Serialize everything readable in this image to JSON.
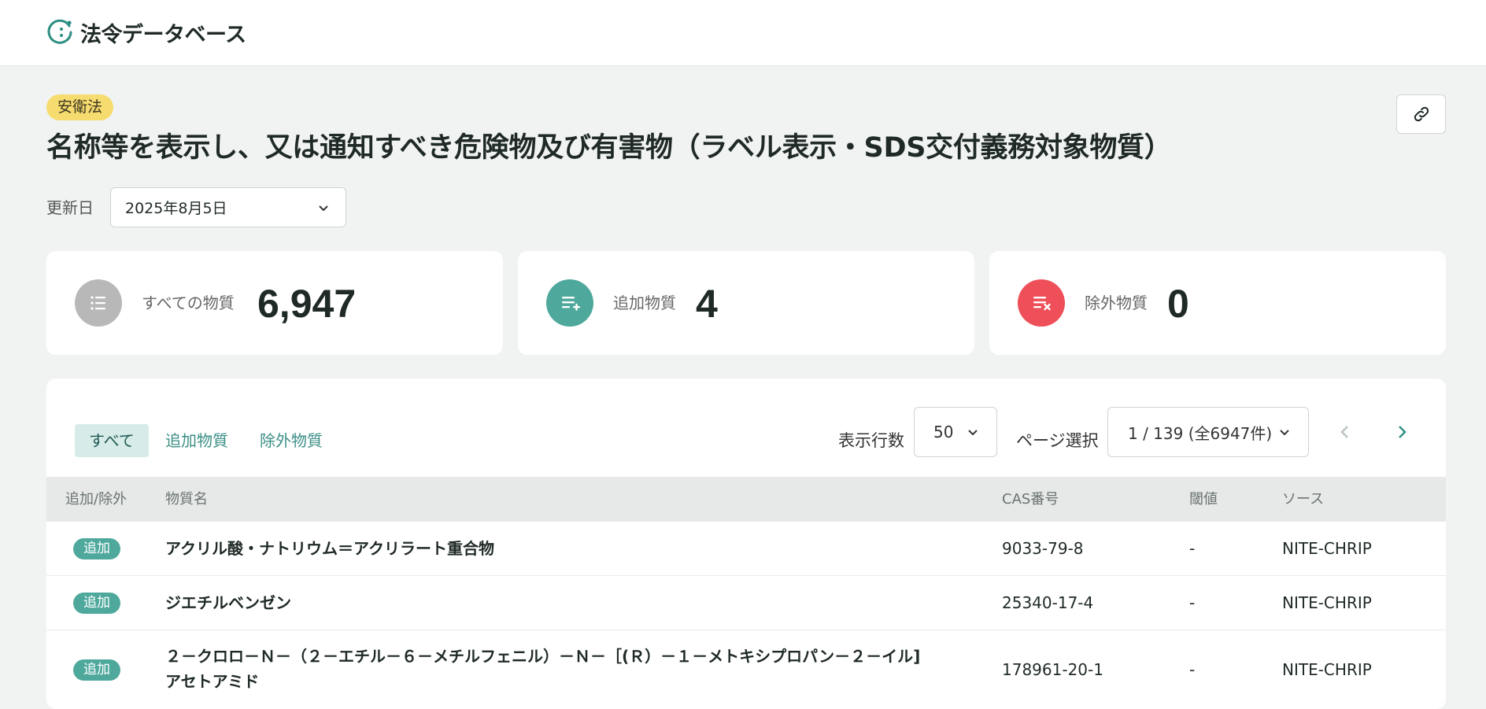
{
  "header": {
    "app_name": "法令データベース"
  },
  "law": {
    "tag": "安衛法",
    "title": "名称等を表示し、又は通知すべき危険物及び有害物（ラベル表示・SDS交付義務対象物質）",
    "date_label": "更新日",
    "date_value": "2025年8月5日"
  },
  "stats": [
    {
      "label": "すべての物質",
      "value": "6,947",
      "icon": "list-icon",
      "color": "#b8b8b8"
    },
    {
      "label": "追加物質",
      "value": "4",
      "icon": "list-add-icon",
      "color": "#4fa89c"
    },
    {
      "label": "除外物質",
      "value": "0",
      "icon": "list-remove-icon",
      "color": "#ee4f58"
    }
  ],
  "filters": {
    "all": "すべて",
    "added": "追加物質",
    "removed": "除外物質"
  },
  "pagination": {
    "rows_label": "表示行数",
    "rows_value": "50",
    "page_label": "ページ選択",
    "page_value": "1 / 139 (全6947件)"
  },
  "table": {
    "headers": {
      "change": "追加/除外",
      "name": "物質名",
      "cas": "CAS番号",
      "threshold": "閾値",
      "source": "ソース"
    },
    "rows": [
      {
        "badge": "追加",
        "name": "アクリル酸・ナトリウム＝アクリラート重合物",
        "cas": "9033-79-8",
        "threshold": "-",
        "source": "NITE-CHRIP"
      },
      {
        "badge": "追加",
        "name": "ジエチルベンゼン",
        "cas": "25340-17-4",
        "threshold": "-",
        "source": "NITE-CHRIP"
      },
      {
        "badge": "追加",
        "name_line1": "２－クロロ－Ｎ－（２－エチル－６－メチルフェニル）－Ｎ－［(Ｒ）－１－メトキシプロパン－２－イル]",
        "name_line2": "アセトアミド",
        "cas": "178961-20-1",
        "threshold": "-",
        "source": "NITE-CHRIP"
      }
    ]
  }
}
